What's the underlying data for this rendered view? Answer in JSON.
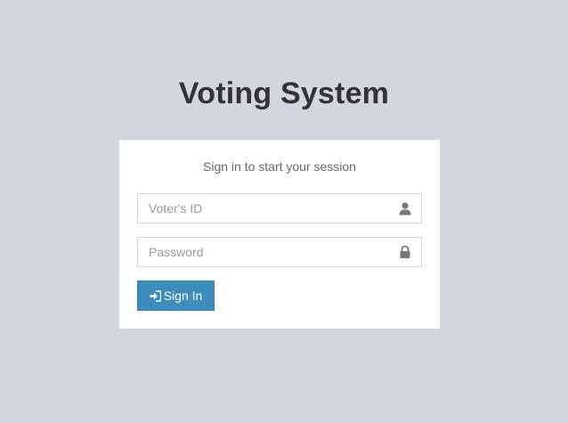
{
  "app": {
    "title": "Voting System"
  },
  "login": {
    "message": "Sign in to start your session",
    "voter_id": {
      "placeholder": "Voter's ID",
      "value": "",
      "icon": "user-icon"
    },
    "password": {
      "placeholder": "Password",
      "value": "",
      "icon": "lock-icon"
    },
    "signin_button": {
      "label": "Sign In",
      "icon": "sign-in-icon"
    }
  },
  "colors": {
    "background": "#d2d6de",
    "box": "#ffffff",
    "primary": "#3c8dbc",
    "title": "#333333"
  }
}
